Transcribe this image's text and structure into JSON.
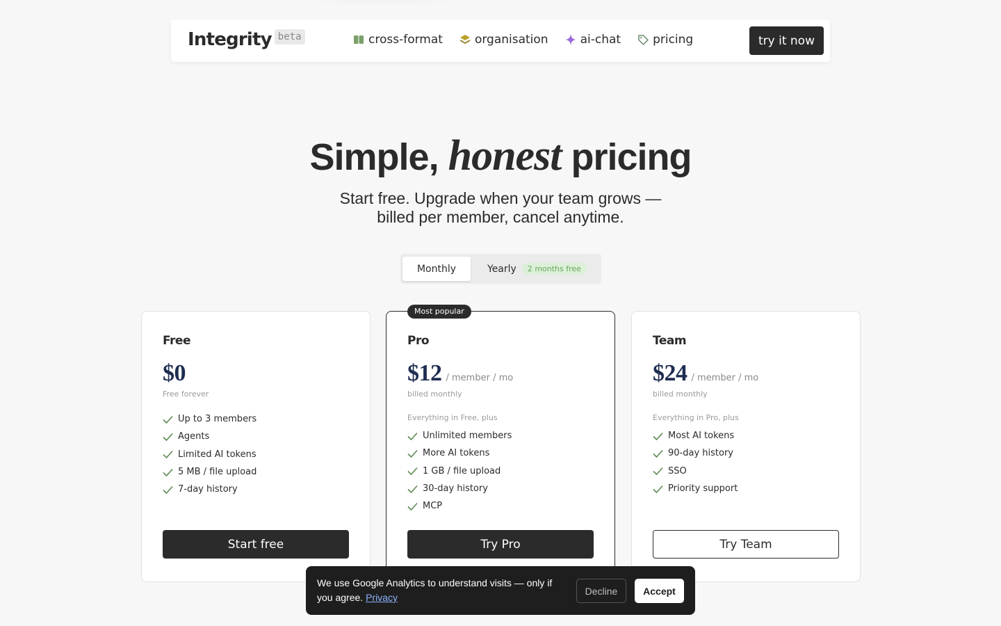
{
  "nav": {
    "brand": "Integrity",
    "beta": "beta",
    "links": [
      {
        "label": "cross-format",
        "icon": "book-icon",
        "color": "#7ba06b"
      },
      {
        "label": "organisation",
        "icon": "layers-icon",
        "color": "#b8a12a"
      },
      {
        "label": "ai-chat",
        "icon": "sparkle-icon",
        "color": "#9b6bde"
      },
      {
        "label": "pricing",
        "icon": "tag-icon",
        "color": "#6b8a6b"
      }
    ],
    "cta": "try it now"
  },
  "hero": {
    "title_start": "Simple,",
    "title_em": "honest",
    "title_end": "pricing",
    "subtitle": "Start free. Upgrade when your team grows — billed per member, cancel anytime."
  },
  "toggle": {
    "monthly": "Monthly",
    "yearly": "Yearly",
    "badge": "2 months free",
    "selected": "Monthly"
  },
  "plans": [
    {
      "name": "Free",
      "price": "$0",
      "per": "",
      "billing": "Free forever",
      "includes": "",
      "features": [
        "Up to 3 members",
        "Agents",
        "Limited AI tokens",
        "5 MB / file upload",
        "7-day history"
      ],
      "cta": "Start free"
    },
    {
      "name": "Pro",
      "badge": "Most popular",
      "price": "$12",
      "per": "/ member / mo",
      "billing": "billed monthly",
      "includes": "Everything in Free, plus",
      "features": [
        "Unlimited members",
        "More AI tokens",
        "1 GB / file upload",
        "30-day history",
        "MCP"
      ],
      "cta": "Try Pro"
    },
    {
      "name": "Team",
      "price": "$24",
      "per": "/ member / mo",
      "billing": "billed monthly",
      "includes": "Everything in Pro, plus",
      "features": [
        "Most AI tokens",
        "90-day history",
        "SSO",
        "Priority support"
      ],
      "cta": "Try Team"
    }
  ],
  "cookie": {
    "text": "We use Google Analytics to understand visits — only if you agree.",
    "link": "Privacy",
    "decline": "Decline",
    "accept": "Accept"
  },
  "colors": {
    "accent_dark": "#2b2b2b",
    "price_navy": "#1f2d52",
    "check_green": "#5e8a52"
  }
}
